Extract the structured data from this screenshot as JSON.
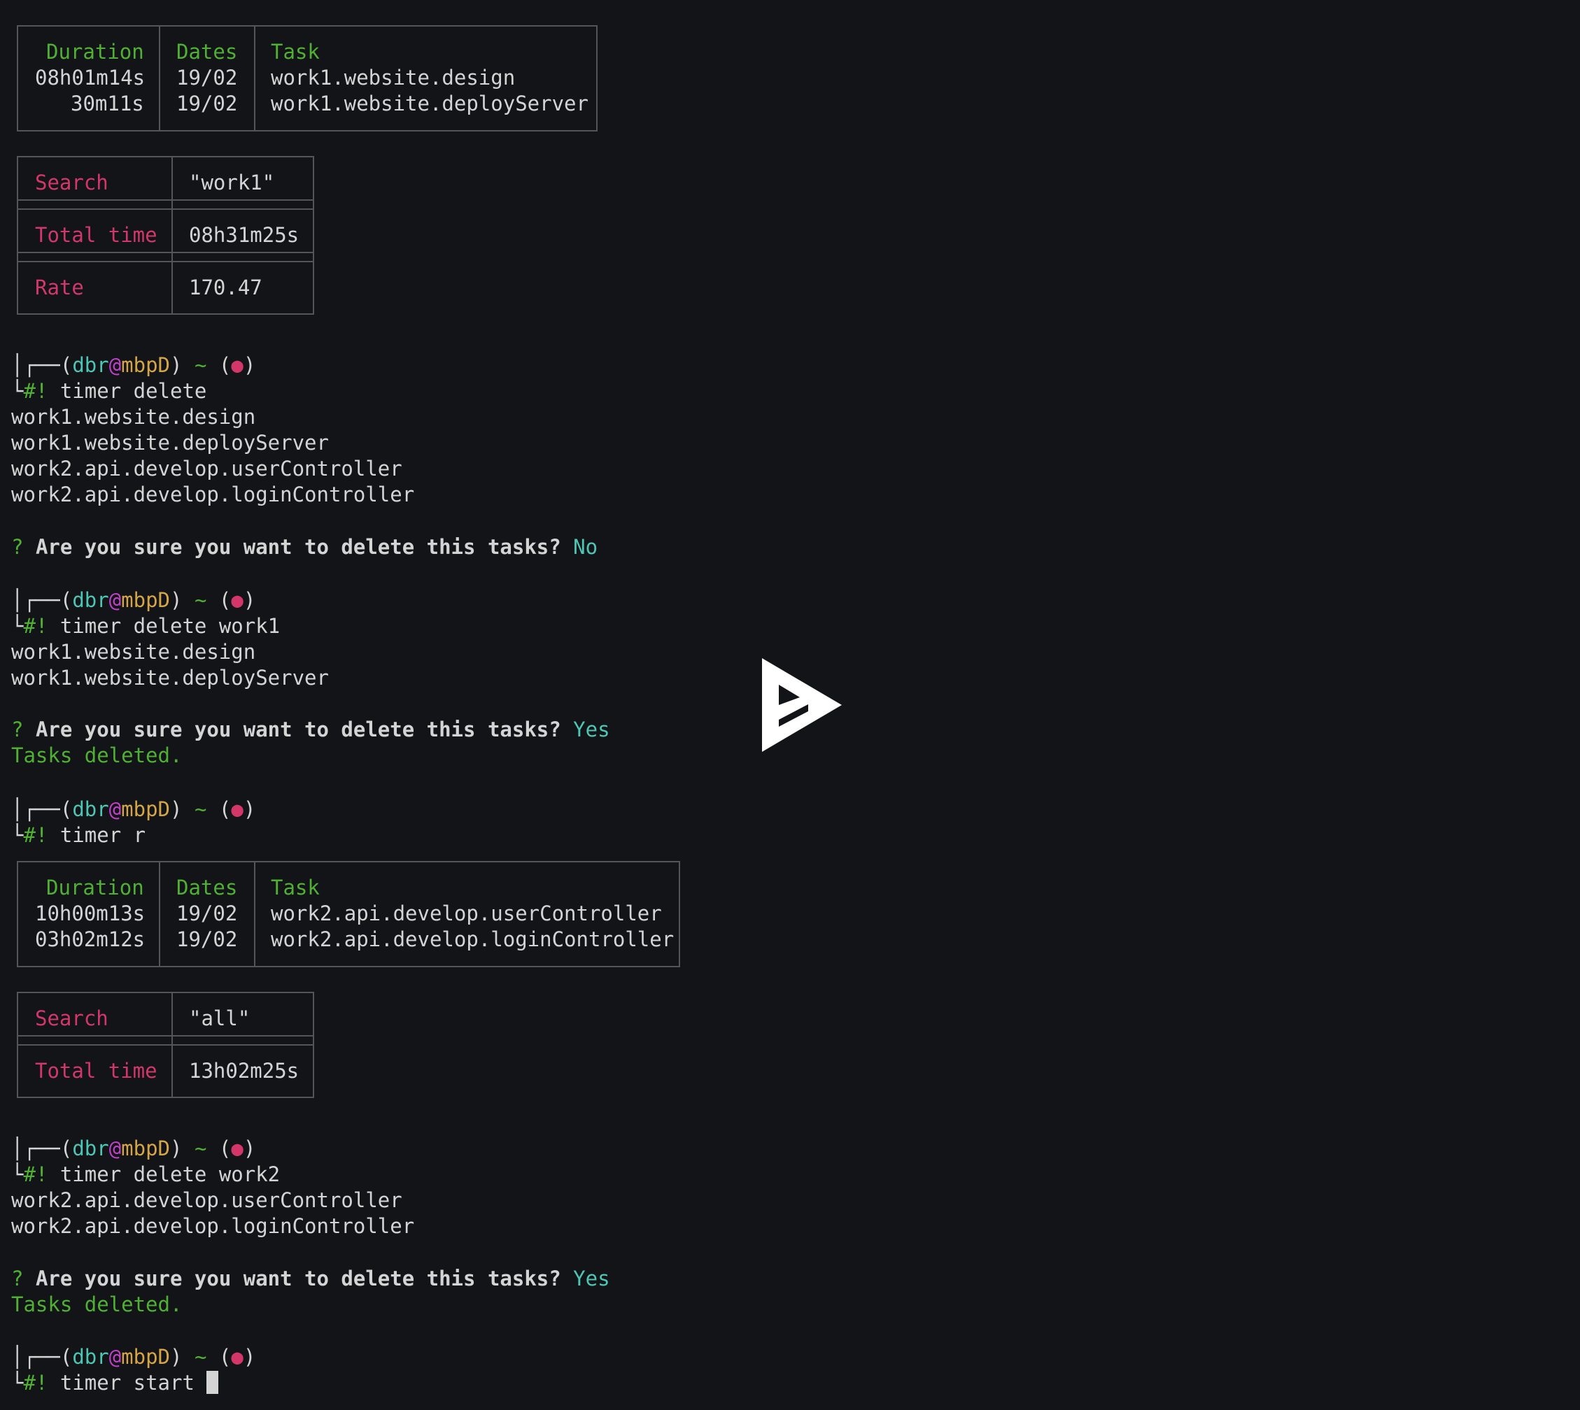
{
  "table1": {
    "headers": {
      "duration": "Duration",
      "dates": "Dates",
      "task": "Task"
    },
    "rows": [
      {
        "duration": "08h01m14s",
        "date": "19/02",
        "task": "work1.website.design"
      },
      {
        "duration": "30m11s",
        "date": "19/02",
        "task": "work1.website.deployServer"
      }
    ]
  },
  "summary1": {
    "search_label": "Search",
    "search_value": "\"work1\"",
    "total_label": "Total time",
    "total_value": "08h31m25s",
    "rate_label": "Rate",
    "rate_value": "170.47"
  },
  "prompt": {
    "top": "│┌──(",
    "user": "dbr",
    "at": "@",
    "host": "mbpD",
    "close": ")",
    "tilde": "~",
    "dot_open": "(",
    "dot": "●",
    "dot_close": ")",
    "bottom": "└",
    "hash": "#!"
  },
  "block1": {
    "command": " timer delete",
    "output": [
      "work1.website.design",
      "work1.website.deployServer",
      "work2.api.develop.userController",
      "work2.api.develop.loginController"
    ],
    "question_mark": "?",
    "question": "Are you sure you want to delete this tasks?",
    "answer": "No"
  },
  "block2": {
    "command": " timer delete work1",
    "output": [
      "work1.website.design",
      "work1.website.deployServer"
    ],
    "question_mark": "?",
    "question": "Are you sure you want to delete this tasks?",
    "answer": "Yes",
    "result": "Tasks deleted."
  },
  "block3": {
    "command": " timer r"
  },
  "table2": {
    "headers": {
      "duration": "Duration",
      "dates": "Dates",
      "task": "Task"
    },
    "rows": [
      {
        "duration": "10h00m13s",
        "date": "19/02",
        "task": "work2.api.develop.userController"
      },
      {
        "duration": "03h02m12s",
        "date": "19/02",
        "task": "work2.api.develop.loginController"
      }
    ]
  },
  "summary2": {
    "search_label": "Search",
    "search_value": "\"all\"",
    "total_label": "Total time",
    "total_value": "13h02m25s"
  },
  "block4": {
    "command": " timer delete work2",
    "output": [
      "work2.api.develop.userController",
      "work2.api.develop.loginController"
    ],
    "question_mark": "?",
    "question": "Are you sure you want to delete this tasks?",
    "answer": "Yes",
    "result": "Tasks deleted."
  },
  "block5": {
    "command": " timer start "
  },
  "colors": {
    "background": "#121417",
    "green": "#4fb033",
    "red": "#d3376a",
    "teal": "#4ec6b4",
    "magenta": "#c040c8",
    "gold": "#d6a548",
    "text": "#d4d4d4"
  },
  "overlay": {
    "icon": "asciinema-play-logo-icon"
  }
}
